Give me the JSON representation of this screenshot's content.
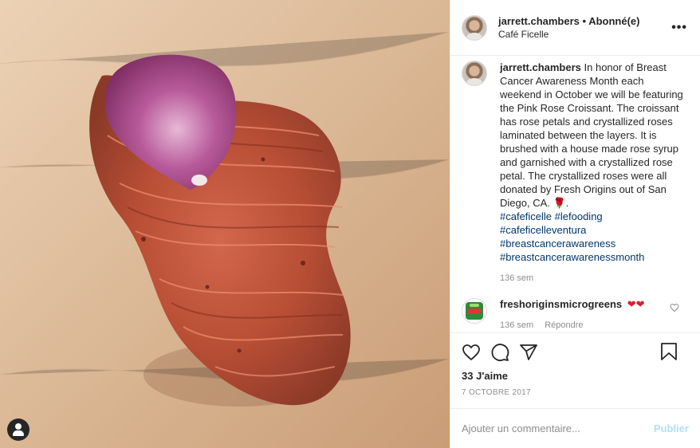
{
  "post": {
    "header": {
      "username": "jarrett.chambers",
      "separator": " • ",
      "follow_status": "Abonné(e)",
      "location": "Café Ficelle",
      "more_label": "•••"
    },
    "caption": {
      "username": "jarrett.chambers",
      "text": "In honor of Breast Cancer Awareness Month each weekend in October we will be featuring the Pink Rose Croissant. The croissant has rose petals and crystallized roses laminated between the layers. It is brushed with a house made rose syrup and garnished with a crystallized rose petal. The crystallized roses were all donated by Fresh Origins out of San Diego, CA. 🌹.",
      "hashtags": [
        "#cafeficelle #lefooding",
        "#cafeficelleventura",
        "#breastcancerawareness",
        "#breastcancerawarenessmonth"
      ],
      "timestamp": "136 sem"
    },
    "comments": [
      {
        "username": "freshoriginsmicrogreens",
        "text": "❤❤",
        "timestamp": "136 sem",
        "reply_label": "Répondre"
      }
    ],
    "likes": "33 J'aime",
    "date": "7 octobre 2017",
    "add_comment": {
      "placeholder": "Ajouter un commentaire...",
      "publish_label": "Publier"
    },
    "colors": {
      "link": "#00376b",
      "muted": "#8e8e8e",
      "publish_disabled": "#b2dffc",
      "heart": "#d6202d"
    },
    "icons": [
      "more-options-icon",
      "heart-icon",
      "comment-icon",
      "share-icon",
      "bookmark-icon",
      "user-tag-icon"
    ]
  }
}
